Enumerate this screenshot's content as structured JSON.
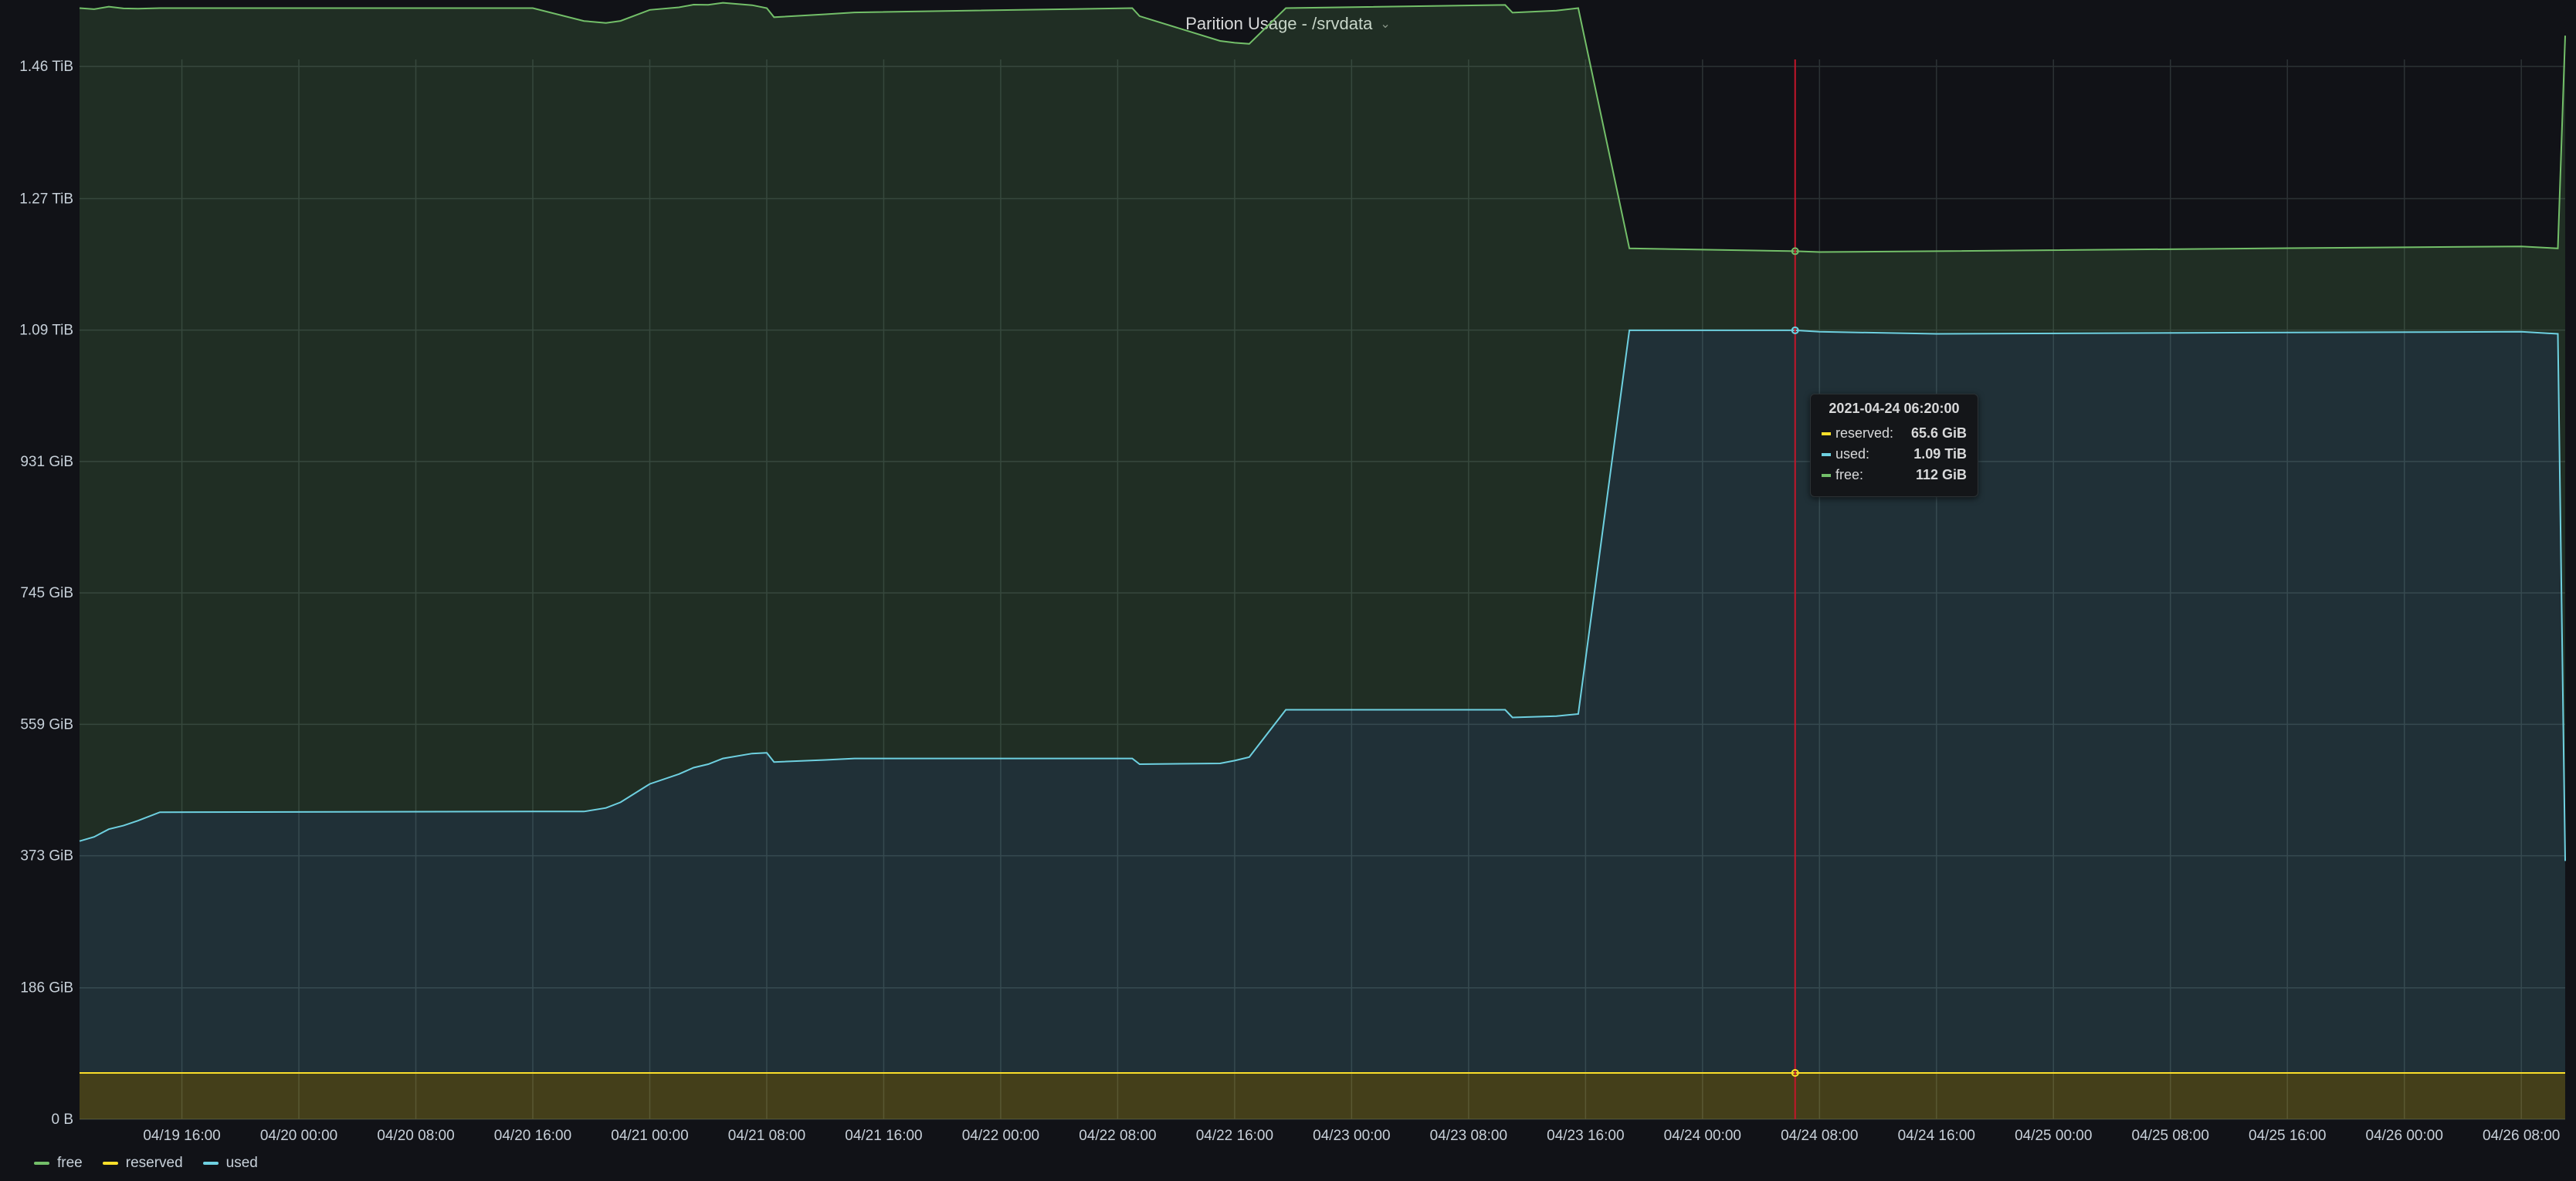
{
  "panel": {
    "title": "Parition Usage - /srvdata",
    "title_caret": "⌄"
  },
  "colors": {
    "free": "#73bf69",
    "reserved": "#fade2a",
    "used": "#8ab8ff",
    "used_line": "#6ed0e0",
    "crosshair": "#c4162a"
  },
  "legend": [
    {
      "name": "free",
      "color": "#73bf69"
    },
    {
      "name": "reserved",
      "color": "#fade2a"
    },
    {
      "name": "used",
      "color": "#6ed0e0"
    }
  ],
  "tooltip": {
    "time": "2021-04-24 06:20:00",
    "rows": [
      {
        "label": "reserved:",
        "value": "65.6 GiB",
        "color": "#fade2a"
      },
      {
        "label": "used:",
        "value": "1.09 TiB",
        "color": "#6ed0e0"
      },
      {
        "label": "free:",
        "value": "112 GiB",
        "color": "#73bf69"
      }
    ]
  },
  "chart_data": {
    "type": "area",
    "stacked": true,
    "title": "Parition Usage - /srvdata",
    "unit": "GiB",
    "ylim": [
      0,
      1500
    ],
    "y_ticks": [
      {
        "value": 0,
        "label": "0 B"
      },
      {
        "value": 186,
        "label": "186 GiB"
      },
      {
        "value": 373,
        "label": "373 GiB"
      },
      {
        "value": 559,
        "label": "559 GiB"
      },
      {
        "value": 745,
        "label": "745 GiB"
      },
      {
        "value": 931,
        "label": "931 GiB"
      },
      {
        "value": 1117,
        "label": "1.09 TiB"
      },
      {
        "value": 1303,
        "label": "1.27 TiB"
      },
      {
        "value": 1490,
        "label": "1.46 TiB"
      }
    ],
    "xlim": [
      "2021-04-19 09:00",
      "2021-04-26 11:00"
    ],
    "x_ticks": [
      {
        "value": "2021-04-19 16:00",
        "label": "04/19 16:00"
      },
      {
        "value": "2021-04-20 00:00",
        "label": "04/20 00:00"
      },
      {
        "value": "2021-04-20 08:00",
        "label": "04/20 08:00"
      },
      {
        "value": "2021-04-20 16:00",
        "label": "04/20 16:00"
      },
      {
        "value": "2021-04-21 00:00",
        "label": "04/21 00:00"
      },
      {
        "value": "2021-04-21 08:00",
        "label": "04/21 08:00"
      },
      {
        "value": "2021-04-21 16:00",
        "label": "04/21 16:00"
      },
      {
        "value": "2021-04-22 00:00",
        "label": "04/22 00:00"
      },
      {
        "value": "2021-04-22 08:00",
        "label": "04/22 08:00"
      },
      {
        "value": "2021-04-22 16:00",
        "label": "04/22 16:00"
      },
      {
        "value": "2021-04-23 00:00",
        "label": "04/23 00:00"
      },
      {
        "value": "2021-04-23 08:00",
        "label": "04/23 08:00"
      },
      {
        "value": "2021-04-23 16:00",
        "label": "04/23 16:00"
      },
      {
        "value": "2021-04-24 00:00",
        "label": "04/24 00:00"
      },
      {
        "value": "2021-04-24 08:00",
        "label": "04/24 08:00"
      },
      {
        "value": "2021-04-24 16:00",
        "label": "04/24 16:00"
      },
      {
        "value": "2021-04-25 00:00",
        "label": "04/25 00:00"
      },
      {
        "value": "2021-04-25 08:00",
        "label": "04/25 08:00"
      },
      {
        "value": "2021-04-25 16:00",
        "label": "04/25 16:00"
      },
      {
        "value": "2021-04-26 00:00",
        "label": "04/26 00:00"
      },
      {
        "value": "2021-04-26 08:00",
        "label": "04/26 08:00"
      }
    ],
    "grid": true,
    "legend_position": "bottom-left",
    "crosshair_time": "2021-04-24 06:20",
    "series": [
      {
        "name": "reserved",
        "stack_order": 1,
        "points": [
          [
            "2021-04-19 09:00",
            65.6
          ],
          [
            "2021-04-26 11:00",
            65.6
          ]
        ]
      },
      {
        "name": "used",
        "stack_order": 2,
        "points": [
          [
            "2021-04-19 09:00",
            328
          ],
          [
            "2021-04-19 10:00",
            334
          ],
          [
            "2021-04-19 11:00",
            345
          ],
          [
            "2021-04-19 12:00",
            350
          ],
          [
            "2021-04-19 13:00",
            357
          ],
          [
            "2021-04-19 14:30",
            369
          ],
          [
            "2021-04-20 16:00",
            370
          ],
          [
            "2021-04-20 19:30",
            370
          ],
          [
            "2021-04-20 21:00",
            375
          ],
          [
            "2021-04-20 22:00",
            383
          ],
          [
            "2021-04-21 00:00",
            409
          ],
          [
            "2021-04-21 02:00",
            423
          ],
          [
            "2021-04-21 03:00",
            432
          ],
          [
            "2021-04-21 04:00",
            437
          ],
          [
            "2021-04-21 05:00",
            445
          ],
          [
            "2021-04-21 07:00",
            452
          ],
          [
            "2021-04-21 08:00",
            453
          ],
          [
            "2021-04-21 08:30",
            440
          ],
          [
            "2021-04-21 12:00",
            443
          ],
          [
            "2021-04-21 14:00",
            445
          ],
          [
            "2021-04-22 09:00",
            445
          ],
          [
            "2021-04-22 09:30",
            437
          ],
          [
            "2021-04-22 15:00",
            438
          ],
          [
            "2021-04-22 16:00",
            442
          ],
          [
            "2021-04-22 17:00",
            447
          ],
          [
            "2021-04-22 19:30",
            514
          ],
          [
            "2021-04-23 10:30",
            514
          ],
          [
            "2021-04-23 11:00",
            503
          ],
          [
            "2021-04-23 14:00",
            505
          ],
          [
            "2021-04-23 15:30",
            508
          ],
          [
            "2021-04-23 19:00",
            1051
          ],
          [
            "2021-04-24 06:20",
            1051
          ],
          [
            "2021-04-24 08:00",
            1049
          ],
          [
            "2021-04-24 16:00",
            1046
          ],
          [
            "2021-04-25 16:00",
            1048
          ],
          [
            "2021-04-26 08:00",
            1049
          ],
          [
            "2021-04-26 10:30",
            1046
          ],
          [
            "2021-04-26 11:00",
            300
          ]
        ]
      },
      {
        "name": "free",
        "stack_order": 3,
        "points": [
          [
            "2021-04-19 09:00",
            1179
          ],
          [
            "2021-04-19 14:30",
            1138
          ],
          [
            "2021-04-20 16:00",
            1137
          ],
          [
            "2021-04-21 08:00",
            1054
          ],
          [
            "2021-04-22 09:00",
            1062
          ],
          [
            "2021-04-22 19:30",
            993
          ],
          [
            "2021-04-23 15:30",
            999
          ],
          [
            "2021-04-23 19:00",
            116
          ],
          [
            "2021-04-24 06:20",
            112
          ],
          [
            "2021-04-24 16:00",
            117
          ],
          [
            "2021-04-26 10:30",
            121
          ],
          [
            "2021-04-26 11:00",
            1168
          ]
        ]
      }
    ]
  }
}
